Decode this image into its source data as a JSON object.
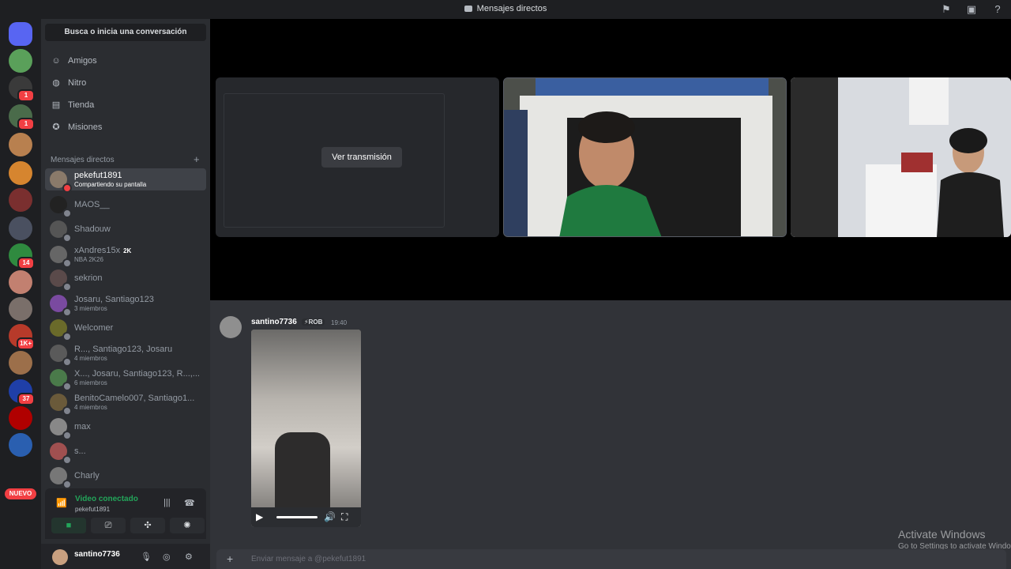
{
  "titlebar": {
    "title": "Mensajes directos",
    "icons": [
      "inbox-flag-icon",
      "inbox-icon",
      "help-icon"
    ]
  },
  "rail": {
    "servers": [
      {
        "icon": "discord-home-icon",
        "color": "#5865f2"
      },
      {
        "color": "#5aa05a",
        "badge": ""
      },
      {
        "color": "#3a3a3a",
        "badge": "1"
      },
      {
        "color": "#4a6b4a",
        "badge": "1"
      },
      {
        "color": "#b8804f",
        "badge": ""
      },
      {
        "color": "#d6852f",
        "badge": ""
      },
      {
        "color": "#7a2f2f",
        "badge": ""
      },
      {
        "color": "#4a5060",
        "badge": ""
      },
      {
        "color": "#2f8a3f",
        "badge": "14"
      },
      {
        "color": "#c28070",
        "badge": ""
      },
      {
        "color": "#7a6f6a",
        "badge": ""
      },
      {
        "color": "#b73a2a",
        "badge": "1K+"
      },
      {
        "color": "#9c6f4a",
        "badge": ""
      },
      {
        "color": "#1f3fa8",
        "badge": "37"
      },
      {
        "color": "#b00000",
        "badge": ""
      },
      {
        "color": "#2a5fb0",
        "badge": ""
      }
    ],
    "new_label": "NUEVO"
  },
  "sidebar": {
    "search_label": "Busca o inicia una conversación",
    "nav": [
      {
        "label": "Amigos",
        "icon": "friends-icon"
      },
      {
        "label": "Nitro",
        "icon": "nitro-icon"
      },
      {
        "label": "Tienda",
        "icon": "shop-icon"
      },
      {
        "label": "Misiones",
        "icon": "quests-icon"
      }
    ],
    "dm_header": "Mensajes directos",
    "dms": [
      {
        "name": "pekefut1891",
        "sub": "Compartiendo su pantalla",
        "active": true,
        "color": "#8a7a6a"
      },
      {
        "name": "MAOS__",
        "sub": "",
        "color": "#222"
      },
      {
        "name": "Shadouw",
        "sub": "",
        "color": "#555"
      },
      {
        "name": "xAndres15x",
        "tag": "2K",
        "sub": "NBA 2K26",
        "color": "#666"
      },
      {
        "name": "sekrion",
        "sub": "",
        "color": "#5a4a4a"
      },
      {
        "name": "Josaru, Santiago123",
        "sub": "3 miembros",
        "color": "#7a4aa0"
      },
      {
        "name": "Welcomer",
        "sub": "",
        "color": "#6a6a2a"
      },
      {
        "name": "R..., Santiago123, Josaru",
        "sub": "4 miembros",
        "color": "#5a5a5a"
      },
      {
        "name": "X..., Josaru, Santiago123, R...,...",
        "sub": "6 miembros",
        "color": "#4a7a4a"
      },
      {
        "name": "BenitoCamelo007, Santiago1...",
        "sub": "4 miembros",
        "color": "#6a5a3a"
      },
      {
        "name": "max",
        "sub": "",
        "color": "#888"
      },
      {
        "name": "s...",
        "sub": "",
        "color": "#a05050"
      },
      {
        "name": "Charly",
        "sub": "",
        "color": "#777"
      }
    ]
  },
  "voice": {
    "status": "Video conectado",
    "channel": "pekefut1891"
  },
  "user": {
    "name": "santino7736"
  },
  "stage": {
    "watch_label": "Ver transmisión"
  },
  "chat": {
    "author": "santino7736",
    "role": "⚡ROB",
    "time": "19:40",
    "composer_placeholder": "Enviar mensaje a @pekefut1891"
  },
  "watermark": {
    "title": "Activate Windows",
    "sub": "Go to Settings to activate Windows."
  }
}
